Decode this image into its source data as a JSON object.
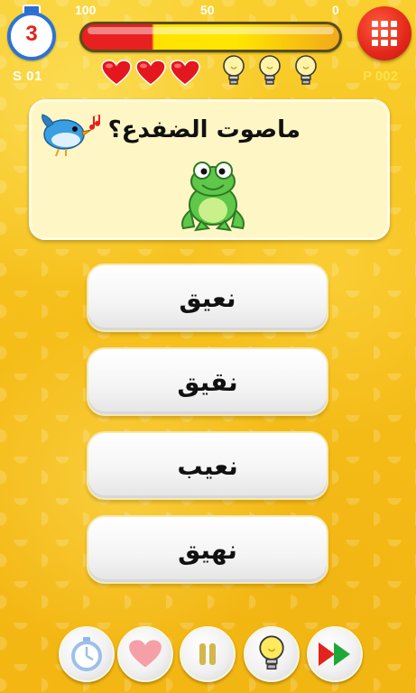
{
  "header": {
    "timer_value": "3",
    "stage_label": "S 01",
    "points_label": "P 002",
    "scale_labels": [
      "100",
      "50",
      "0"
    ],
    "hearts": 3,
    "hints": 3
  },
  "question": {
    "text": "ماصوت الضفدع؟",
    "image": "frog",
    "sound_icon": "bird-singing-icon"
  },
  "answers": [
    {
      "label": "نعيق"
    },
    {
      "label": "نقيق"
    },
    {
      "label": "نعيب"
    },
    {
      "label": "نهيق"
    }
  ],
  "toolbar": [
    "stopwatch-icon",
    "heart-icon",
    "pause-icon",
    "lightbulb-icon",
    "skip-forward-icon"
  ],
  "colors": {
    "background": "#f7c21e",
    "bar_red": "#e82020",
    "bar_yellow": "#ffe300",
    "menu_red": "#e3271b",
    "timer_blue": "#2d73d6"
  }
}
